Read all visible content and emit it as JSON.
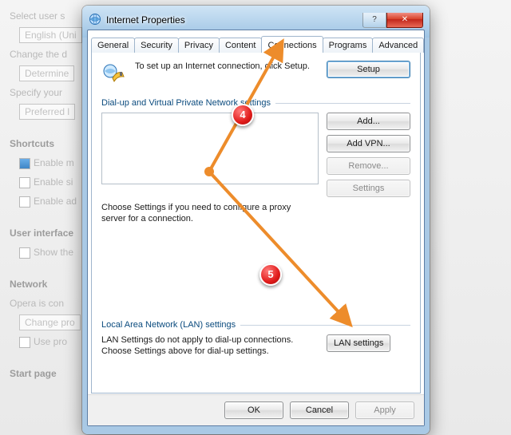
{
  "bg": {
    "l1": "Select user s",
    "l1b": "English (Uni",
    "l2": "Change the d",
    "l2b": "Determine",
    "l3": "Specify your",
    "l3b": "Preferred l",
    "sc_head": "Shortcuts",
    "sc1": "Enable m",
    "sc2": "Enable si",
    "sc3": "Enable ad",
    "ui_head": "User interface",
    "ui1": "Show the",
    "net_head": "Network",
    "net1": "Opera is con",
    "net1b": "Change pro",
    "net2": "Use pro",
    "sp_head": "Start page"
  },
  "dialog": {
    "title": "Internet Properties",
    "help_glyph": "?",
    "close_glyph": "✕",
    "tabs": [
      "General",
      "Security",
      "Privacy",
      "Content",
      "Connections",
      "Programs",
      "Advanced"
    ],
    "setup_text": "To set up an Internet connection, click Setup.",
    "setup_btn": "Setup",
    "group1": "Dial-up and Virtual Private Network settings",
    "add_btn": "Add...",
    "addvpn_btn": "Add VPN...",
    "remove_btn": "Remove...",
    "settings_btn": "Settings",
    "hint1": "Choose Settings if you need to configure a proxy server for a connection.",
    "group2": "Local Area Network (LAN) settings",
    "lan_text": "LAN Settings do not apply to dial-up connections. Choose Settings above for dial-up settings.",
    "lan_btn": "LAN settings",
    "ok": "OK",
    "cancel": "Cancel",
    "apply": "Apply"
  },
  "annot": {
    "step4": "4",
    "step5": "5"
  }
}
